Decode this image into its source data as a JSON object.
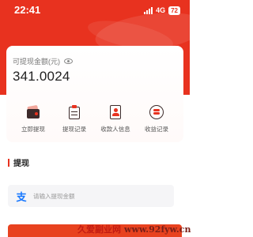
{
  "status_bar": {
    "time": "22:41",
    "network": "4G",
    "battery": "72"
  },
  "balance": {
    "label": "可提现金额(元)",
    "value": "341.0024"
  },
  "actions": [
    {
      "label": "立即提现",
      "icon": "wallet-icon"
    },
    {
      "label": "提现记录",
      "icon": "clipboard-icon"
    },
    {
      "label": "收款人信息",
      "icon": "contact-icon"
    },
    {
      "label": "收益记录",
      "icon": "coins-icon"
    }
  ],
  "withdraw": {
    "title": "提现",
    "amount_placeholder": "请输入提现金额",
    "amount_value": ""
  },
  "watermark": {
    "text_cn": "久爱副业网",
    "url": "www.92fyw.cn"
  },
  "colors": {
    "brand": "#e8321f",
    "accent_blue": "#1677ff"
  }
}
